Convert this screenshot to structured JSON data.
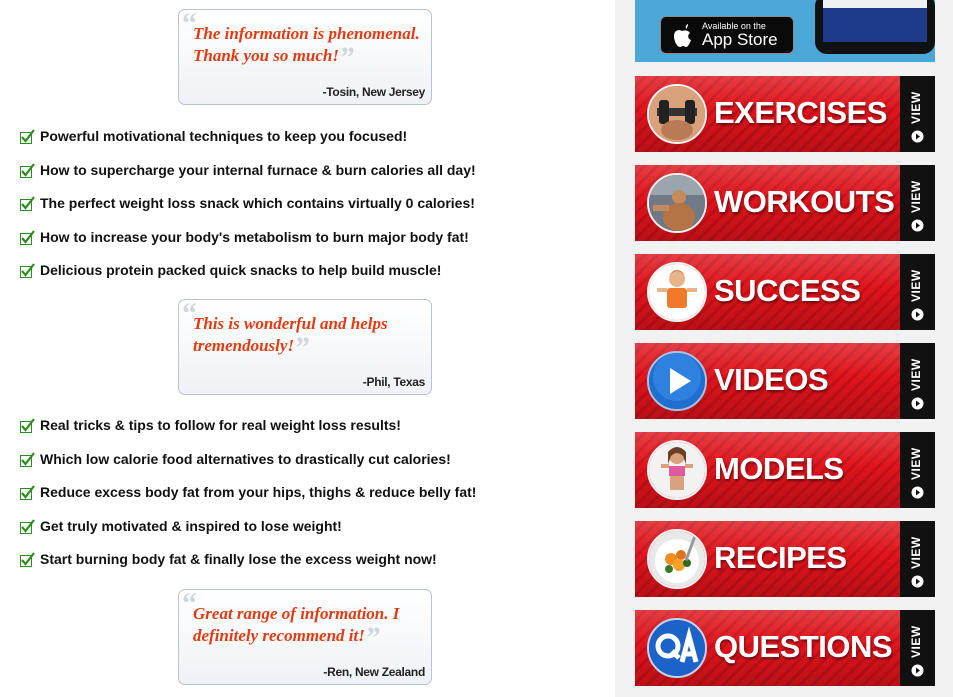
{
  "testimonials": [
    {
      "quote": "The information is phenomenal. Thank you so much!",
      "author": "-Tosin, New Jersey"
    },
    {
      "quote": "This is wonderful and helps tremendously!",
      "author": "-Phil, Texas"
    },
    {
      "quote": "Great range of information. I definitely recommend it!",
      "author": "-Ren, New Zealand"
    }
  ],
  "benefits_a": [
    "Powerful motivational techniques to keep you focused!",
    "How to supercharge your internal furnace & burn calories all day!",
    "The perfect weight loss snack which contains virtually 0 calories!",
    "How to increase your body's metabolism to burn major body fat!",
    "Delicious protein packed quick snacks to help build muscle!"
  ],
  "benefits_b": [
    "Real tricks & tips to follow for real weight loss results!",
    "Which low calorie food alternatives to drastically cut calories!",
    "Reduce excess body fat from your hips, thighs & reduce belly fat!",
    "Get truly motivated & inspired to lose weight!",
    "Start burning body fat & finally lose the excess weight now!"
  ],
  "app_store": {
    "small": "Available on the",
    "big": "App Store"
  },
  "nav": [
    {
      "label": "EXERCISES",
      "icon": "dumbbell-icon"
    },
    {
      "label": "WORKOUTS",
      "icon": "bodybuilder-icon"
    },
    {
      "label": "SUCCESS",
      "icon": "woman-success-icon"
    },
    {
      "label": "VIDEOS",
      "icon": "play-icon"
    },
    {
      "label": "MODELS",
      "icon": "fitness-model-icon"
    },
    {
      "label": "RECIPES",
      "icon": "food-plate-icon"
    },
    {
      "label": "QUESTIONS",
      "icon": "qa-icon"
    }
  ],
  "view_label": "VIEW",
  "colors": {
    "accent_red": "#e0141c",
    "quote_orange": "#e43a12",
    "check_green": "#2e8b1e",
    "banner_blue": "#4aa7d8"
  }
}
